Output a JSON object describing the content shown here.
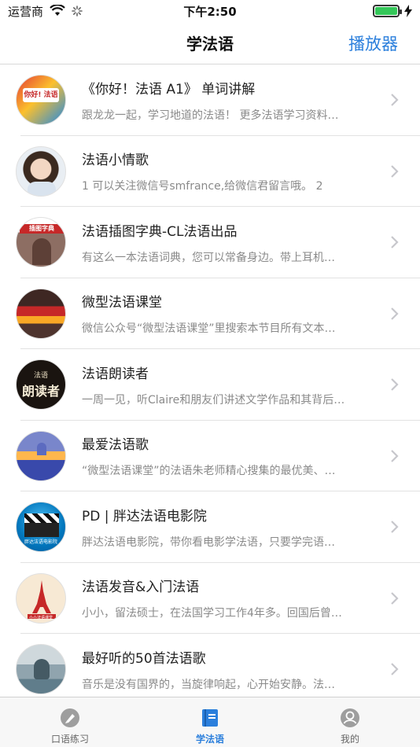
{
  "status": {
    "carrier": "运营商",
    "time": "下午2:50",
    "battery_level": 1.0
  },
  "nav": {
    "title": "学法语",
    "right_action": "播放器"
  },
  "items": [
    {
      "title": "《你好！法语 A1》 单词讲解",
      "subtitle": "跟龙龙一起，学习地道的法语！ 更多法语学习资料…"
    },
    {
      "title": "法语小情歌",
      "subtitle": "1 可以关注微信号smfrance,给微信君留言哦。 2"
    },
    {
      "title": "法语插图字典-CL法语出品",
      "subtitle": "有这么一本法语词典，您可以常备身边。带上耳机…"
    },
    {
      "title": "微型法语课堂",
      "subtitle": "微信公众号“微型法语课堂”里搜索本节目所有文本…"
    },
    {
      "title": "法语朗读者",
      "subtitle": "一周一见，听Claire和朋友们讲述文学作品和其背后…"
    },
    {
      "title": "最爱法语歌",
      "subtitle": "“微型法语课堂”的法语朱老师精心搜集的最优美、…"
    },
    {
      "title": "PD | 胖达法语电影院",
      "subtitle": "胖达法语电影院，带你看电影学法语，只要学完语…"
    },
    {
      "title": "法语发音&入门法语",
      "subtitle": "小小，留法硕士，在法国学习工作4年多。回国后曾…"
    },
    {
      "title": "最好听的50首法语歌",
      "subtitle": "音乐是没有国界的，当旋律响起，心开始安静。法…"
    }
  ],
  "thumbnails": {
    "t1": "你好! 法语",
    "t3": "插图字典",
    "t5a": "法语",
    "t5b": "朗读者",
    "t7": "胖达法语电影院",
    "t8": "小小法语课堂"
  },
  "tabs": [
    {
      "label": "口语练习",
      "icon": "pencil-eraser-icon"
    },
    {
      "label": "学法语",
      "icon": "book-icon",
      "active": true
    },
    {
      "label": "我的",
      "icon": "profile-icon"
    }
  ],
  "colors": {
    "accent": "#2b7fdc",
    "separator": "#e2e2e2",
    "subtitle": "#8a8a8a"
  }
}
